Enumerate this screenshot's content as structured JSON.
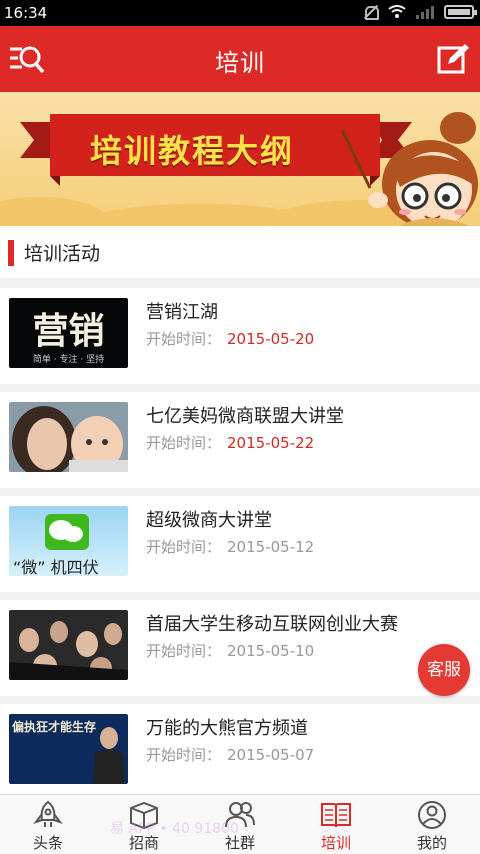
{
  "status_bar": {
    "time": "16:34"
  },
  "app_bar": {
    "title": "培训",
    "left_icon": "menu-search-icon",
    "right_icon": "edit-icon"
  },
  "banner": {
    "text": "培训教程大纲"
  },
  "section": {
    "title": "培训活动"
  },
  "date_prefix": "开始时间：",
  "activities": [
    {
      "title": "营销江湖",
      "date": "2015-05-20",
      "date_color": "#cc2b26",
      "thumb_text": "营销",
      "thumb_sub": "简单 · 专注 · 坚持"
    },
    {
      "title": "七亿美妈微商联盟大讲堂",
      "date": "2015-05-22",
      "date_color": "#cc2b26"
    },
    {
      "title": "超级微商大讲堂",
      "date": "2015-05-12",
      "date_color": "#999999",
      "thumb_text": "“微”  机四伏"
    },
    {
      "title": "首届大学生移动互联网创业大赛",
      "date": "2015-05-10",
      "date_color": "#999999"
    },
    {
      "title": "万能的大熊官方频道",
      "date": "2015-05-07",
      "date_color": "#999999",
      "thumb_text": "偏执狂才能生存"
    }
  ],
  "service_button": {
    "label": "客服"
  },
  "tabs": [
    {
      "label": "头条",
      "icon": "rocket-icon"
    },
    {
      "label": "招商",
      "icon": "box-icon"
    },
    {
      "label": "社群",
      "icon": "group-icon"
    },
    {
      "label": "培训",
      "icon": "book-icon",
      "active": true
    },
    {
      "label": "我的",
      "icon": "user-icon"
    }
  ],
  "watermark": "易 APP • 40      91800 "
}
